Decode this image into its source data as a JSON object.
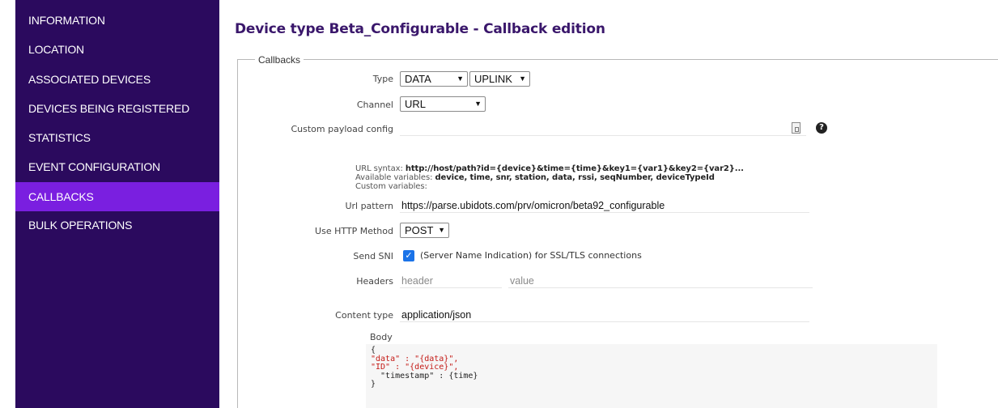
{
  "sidebar": {
    "items": [
      {
        "label": "INFORMATION"
      },
      {
        "label": "LOCATION"
      },
      {
        "label": "ASSOCIATED DEVICES"
      },
      {
        "label": "DEVICES BEING REGISTERED"
      },
      {
        "label": "STATISTICS"
      },
      {
        "label": "EVENT CONFIGURATION"
      },
      {
        "label": "CALLBACKS"
      },
      {
        "label": "BULK OPERATIONS"
      }
    ],
    "active_item": "CALLBACKS",
    "bg_color": "#2b0a5e",
    "active_color": "#7a1fe0"
  },
  "page": {
    "title": "Device type Beta_Configurable - Callback edition"
  },
  "callbacks": {
    "legend": "Callbacks",
    "type_label": "Type",
    "type_value": "DATA",
    "direction_value": "UPLINK",
    "channel_label": "Channel",
    "channel_value": "URL",
    "custom_payload_label": "Custom payload config",
    "custom_payload_value": "",
    "url_syntax_label": "URL syntax:",
    "url_syntax_value": "http://host/path?id={device}&time={time}&key1={var1}&key2={var2}...",
    "available_vars_label": "Available variables:",
    "available_vars_value": "device, time, snr, station, data, rssi, seqNumber, deviceTypeId",
    "custom_vars_label": "Custom variables:",
    "url_pattern_label": "Url pattern",
    "url_pattern_value": "https://parse.ubidots.com/prv/omicron/beta92_configurable",
    "http_method_label": "Use HTTP Method",
    "http_method_value": "POST",
    "send_sni_label": "Send SNI",
    "send_sni_checked": true,
    "send_sni_text": "(Server Name Indication) for SSL/TLS connections",
    "headers_label": "Headers",
    "header_placeholder": "header",
    "value_placeholder": "value",
    "content_type_label": "Content type",
    "content_type_value": "application/json",
    "body_label": "Body",
    "body_lines": [
      "{",
      "\"data\" : \"{data}\",",
      "\"ID\" : \"{device}\",",
      "  \"timestamp\" : {time}",
      "}"
    ]
  },
  "icons": [
    "help-icon",
    "document-icon",
    "chevron-down-icon",
    "checkmark-icon"
  ]
}
